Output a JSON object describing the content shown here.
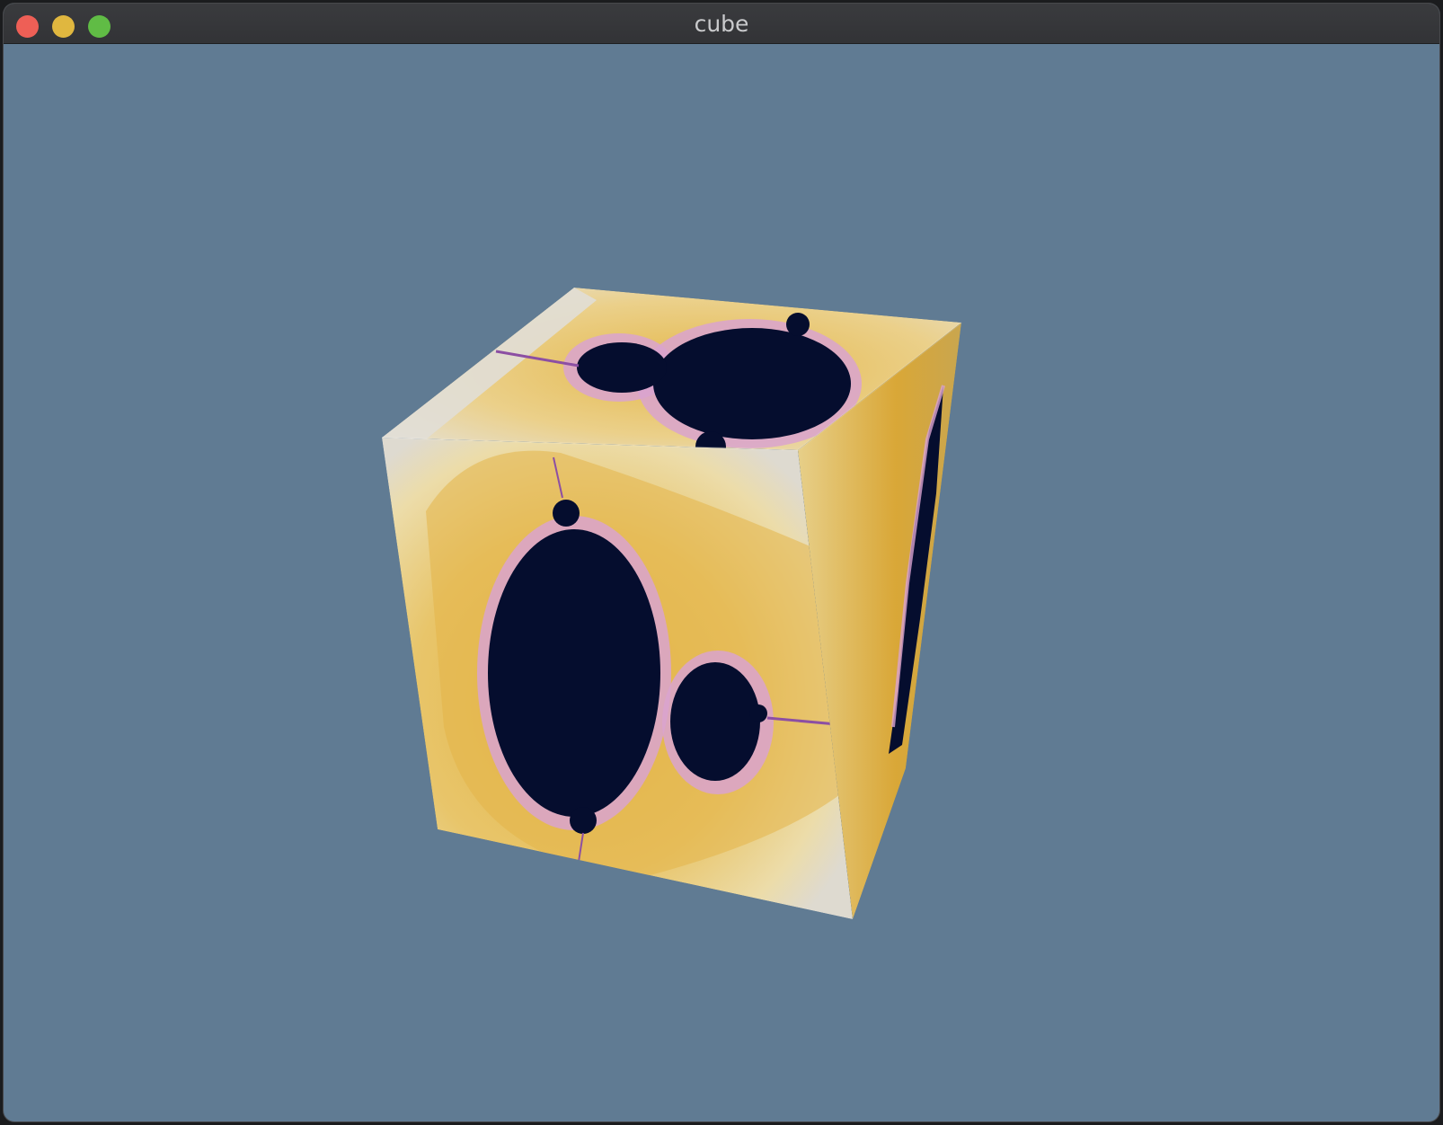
{
  "window": {
    "title": "cube",
    "background_color": "#607b93",
    "controls": [
      "close-button",
      "minimize-button",
      "zoom-button"
    ]
  },
  "scene": {
    "object": "cube",
    "texture": "mandelbrot-fractal",
    "texture_colors": {
      "set": "#050d2e",
      "outer": "#eadcaa",
      "band": "#e5b94a",
      "edge": "#d9a3cf"
    }
  }
}
